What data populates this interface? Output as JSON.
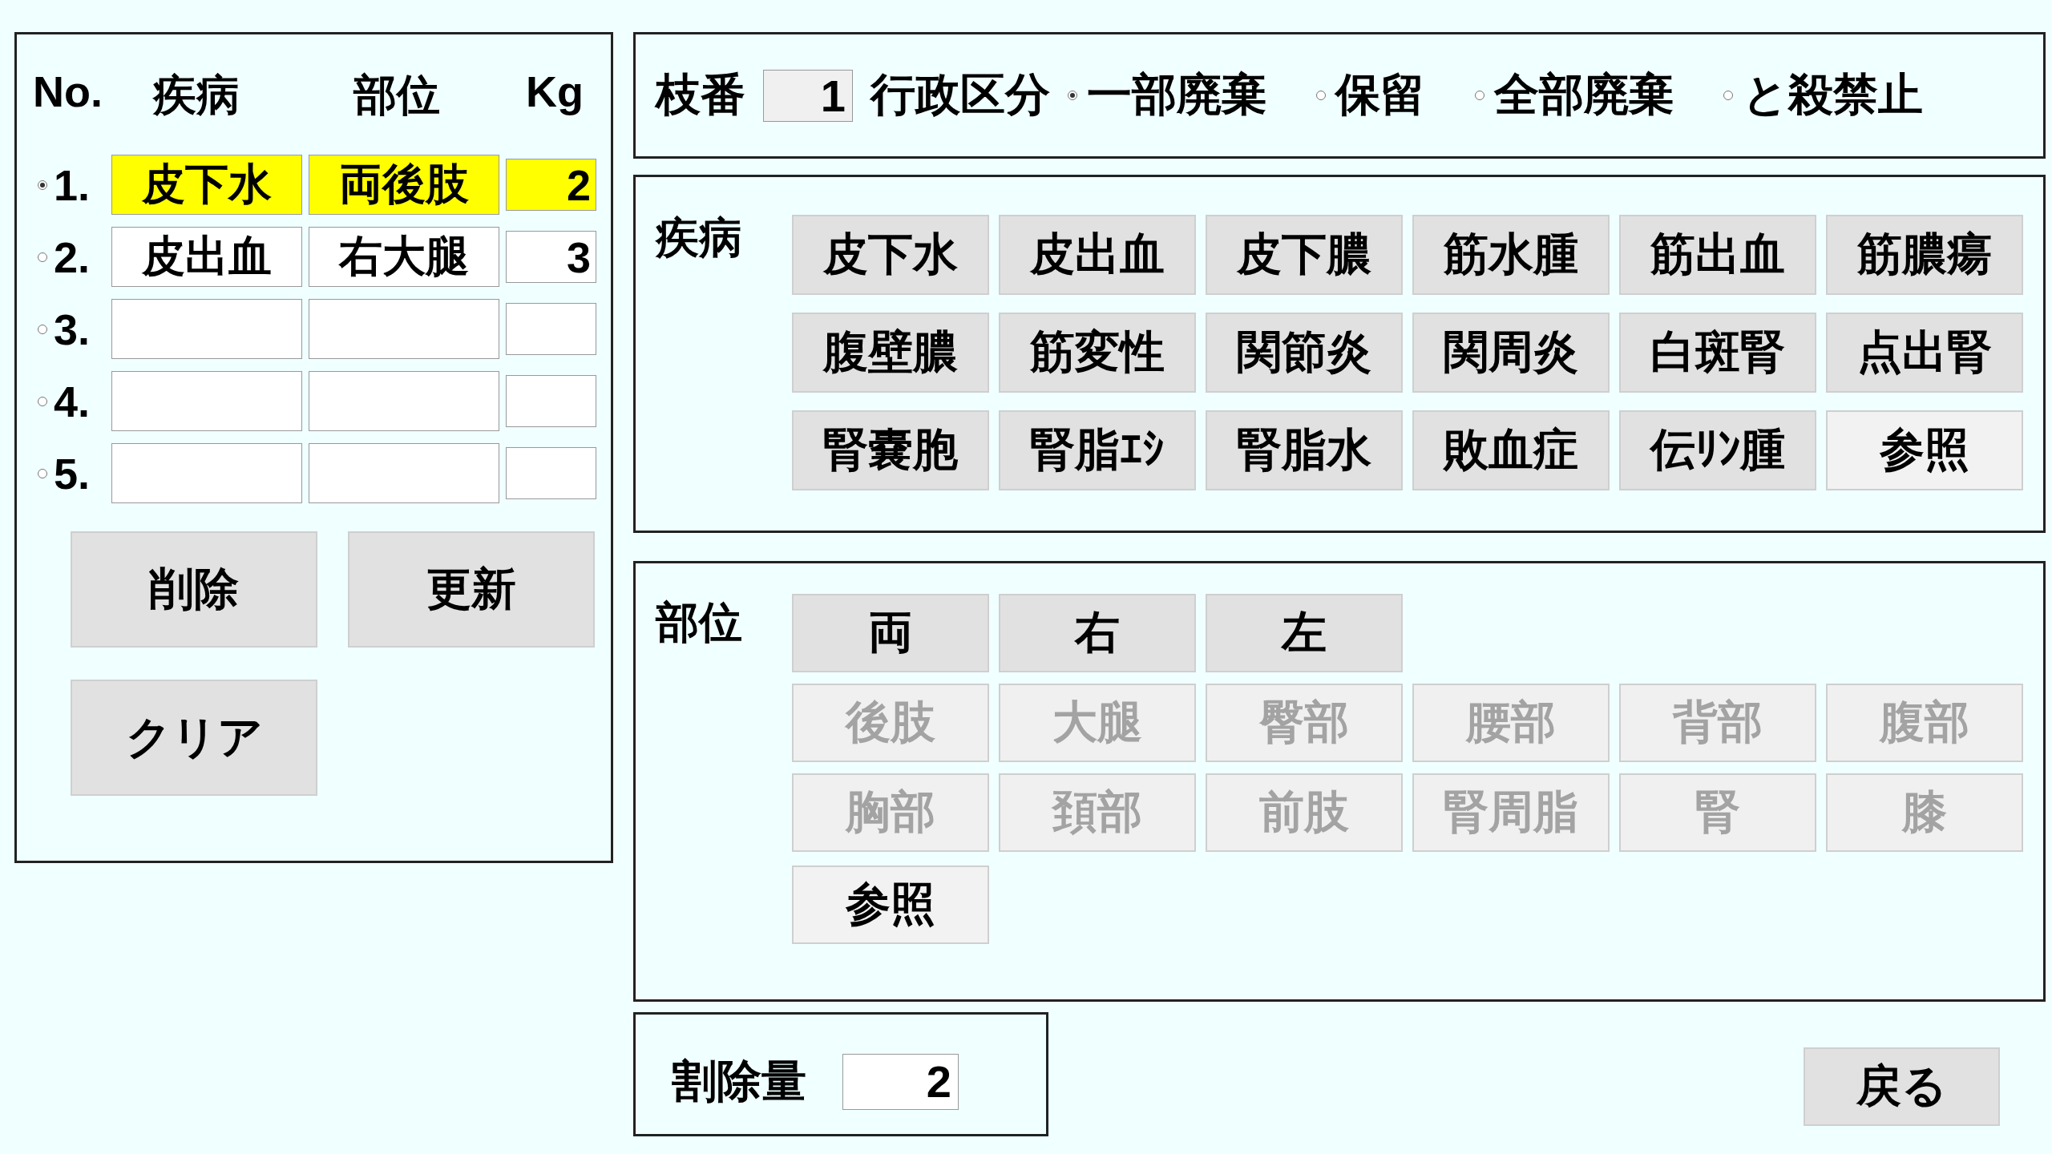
{
  "list": {
    "columns": [
      "No.",
      "疾病",
      "部位",
      "Kg"
    ],
    "rows": [
      {
        "no": "1.",
        "selected": true,
        "disease": "皮下水",
        "site": "両後肢",
        "kg": "2"
      },
      {
        "no": "2.",
        "selected": false,
        "disease": "皮出血",
        "site": "右大腿",
        "kg": "3"
      },
      {
        "no": "3.",
        "selected": false
      },
      {
        "no": "4.",
        "selected": false
      },
      {
        "no": "5.",
        "selected": false
      }
    ],
    "buttons": [
      "削除",
      "更新",
      "クリア"
    ]
  },
  "admin": {
    "branch_label": "枝番",
    "branch_value": "1",
    "category_label": "行政区分",
    "options": [
      {
        "label": "一部廃棄",
        "selected": true
      },
      {
        "label": "保留",
        "selected": false
      },
      {
        "label": "全部廃棄",
        "selected": false
      },
      {
        "label": "と殺禁止",
        "selected": false
      }
    ]
  },
  "disease": {
    "title": "疾病",
    "rows": [
      [
        {
          "label": "皮下水",
          "kind": "code"
        },
        {
          "label": "皮出血",
          "kind": "code"
        },
        {
          "label": "皮下膿",
          "kind": "code"
        },
        {
          "label": "筋水腫",
          "kind": "code"
        },
        {
          "label": "筋出血",
          "kind": "code"
        },
        {
          "label": "筋膿瘍",
          "kind": "code"
        }
      ],
      [
        {
          "label": "腹壁膿",
          "kind": "code"
        },
        {
          "label": "筋変性",
          "kind": "code"
        },
        {
          "label": "関節炎",
          "kind": "code"
        },
        {
          "label": "関周炎",
          "kind": "code"
        },
        {
          "label": "白斑腎",
          "kind": "code"
        },
        {
          "label": "点出腎",
          "kind": "code"
        }
      ],
      [
        {
          "label": "腎嚢胞",
          "kind": "code"
        },
        {
          "label": "腎脂ｴｼ",
          "kind": "code"
        },
        {
          "label": "腎脂水",
          "kind": "code"
        },
        {
          "label": "敗血症",
          "kind": "code"
        },
        {
          "label": "伝ﾘﾝ腫",
          "kind": "code"
        },
        {
          "label": "参照",
          "kind": "reference"
        }
      ]
    ]
  },
  "site": {
    "title": "部位",
    "rows": [
      [
        {
          "label": "両",
          "kind": "code",
          "disabled": false
        },
        {
          "label": "右",
          "kind": "code",
          "disabled": false
        },
        {
          "label": "左",
          "kind": "code",
          "disabled": false
        }
      ],
      [
        {
          "label": "後肢",
          "kind": "code",
          "disabled": true
        },
        {
          "label": "大腿",
          "kind": "code",
          "disabled": true
        },
        {
          "label": "臀部",
          "kind": "code",
          "disabled": true
        },
        {
          "label": "腰部",
          "kind": "code",
          "disabled": true
        },
        {
          "label": "背部",
          "kind": "code",
          "disabled": true
        },
        {
          "label": "腹部",
          "kind": "code",
          "disabled": true
        }
      ],
      [
        {
          "label": "胸部",
          "kind": "code",
          "disabled": true
        },
        {
          "label": "頚部",
          "kind": "code",
          "disabled": true
        },
        {
          "label": "前肢",
          "kind": "code",
          "disabled": true
        },
        {
          "label": "腎周脂",
          "kind": "code",
          "disabled": true
        },
        {
          "label": "腎",
          "kind": "code",
          "disabled": true
        },
        {
          "label": "膝",
          "kind": "code",
          "disabled": true
        }
      ],
      [
        {
          "label": "参照",
          "kind": "reference",
          "disabled": false
        }
      ]
    ]
  },
  "amount": {
    "label": "割除量",
    "value": "2"
  },
  "back_button": "戻る"
}
